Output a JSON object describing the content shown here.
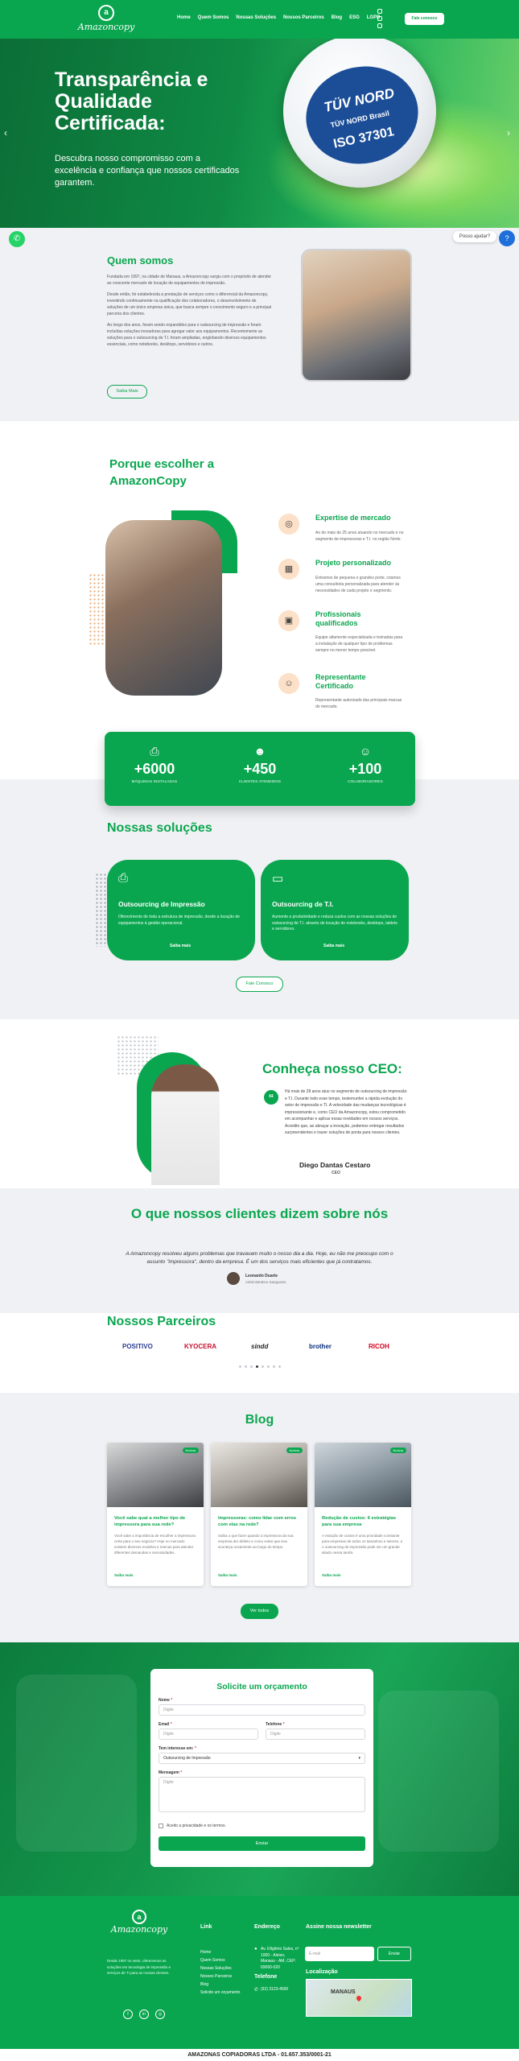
{
  "header": {
    "logo_text": "Amazoncopy",
    "nav": [
      "Home",
      "Quem Somos",
      "Nossas Soluções",
      "Nossos Parceiros",
      "Blog",
      "ESG",
      "LGPD"
    ],
    "cta": "Fale conosco"
  },
  "hero": {
    "title": "Transparência e Qualidade Certificada:",
    "subtitle": "Descubra nosso compromisso com a excelência e confiança que nossos certificados garantem.",
    "badge_line1": "TÜV NORD",
    "badge_line2": "TÜV NORD Brasil",
    "badge_line3": "ISO 37301"
  },
  "float": {
    "help": "Posso ajudar?"
  },
  "about": {
    "title": "Quem somos",
    "p1": "Fundada em 1997, na cidade de Manaus, a Amazoncopy surgiu com o propósito de atender ao crescente mercado de locação de equipamentos de impressão.",
    "p2": "Desde então, foi estabelecida a prestação de serviços como o diferencial da Amazoncopy, investindo continuamente na qualificação dos colaboradores, o desenvolvimento de soluções de um único empresa única, que busca sempre o crescimento seguro e a principal parceria dos clientes.",
    "p3": "Ao longo dos anos, foram sendo expandidos para o outsourcing de impressão e foram incluídas soluções inovadoras para agregar valor aos equipamentos. Recentemente as soluções para o outsourcing de T.I. foram ampliadas, englobando diversos equipamentos essenciais, como notebooks, desktops, servidores e outros.",
    "button": "Saiba Mais"
  },
  "why": {
    "title": "Porque escolher a AmazonCopy",
    "features": [
      {
        "title": "Expertise de mercado",
        "text": "Ao do mais de 25 anos atuando no mercado e no segmento de impressoras e T.I. no região Norte."
      },
      {
        "title": "Projeto personalizado",
        "text": "Entramos de pequena e grandes porte, criamos uma consultoria personalizada para atender às necessidades de cada projeto e segmento."
      },
      {
        "title": "Profissionais qualificados",
        "text": "Equipe altamente especializada e treinadas para a instalação de qualquer tipo de problemas sempre no menor tempo possível."
      },
      {
        "title": "Representante Certificado",
        "text": "Representante autorizado das principais marcas do mercado."
      }
    ]
  },
  "stats": [
    {
      "number": "+6000",
      "label": "MÁQUINAS INSTALADAS"
    },
    {
      "number": "+450",
      "label": "CLIENTES ATENDIDOS"
    },
    {
      "number": "+100",
      "label": "COLABORADORES"
    }
  ],
  "solutions": {
    "title": "Nossas soluções",
    "cards": [
      {
        "title": "Outsourcing de Impressão",
        "text": "Oferecimento de toda a estrutura de impressão, desde a locação de equipamentos à gestão operacional.",
        "more": "Saiba mais"
      },
      {
        "title": "Outsourcing de T.I.",
        "text": "Aumente a produtividade e reduza custos com as nossas soluções de outsourcing de T.I. através de locação de notebooks, desktops, tablets e servidores.",
        "more": "Saiba mais"
      }
    ],
    "button": "Fale Conosco"
  },
  "ceo": {
    "title": "Conheça nosso CEO:",
    "text": "Há mais de 28 anos atuo no segmento de outsourcing de impressão e T.I. Durante todo esse tempo, testemunhei a rápida evolução do setor de impressão e TI. A velocidade das mudanças tecnológicas é impressionante e, como CEO da Amazoncopy, estou comprometido em acompanhar e aplicar essas novidades em nossos serviços. Acredito que, ao abraçar a inovação, podemos entregar resultados surpreendentes e trazer soluções de ponta para nossos clientes.",
    "name": "Diego Dantas Cestaro",
    "role": "CEO"
  },
  "testimonials": {
    "title": "O que nossos clientes dizem sobre nós",
    "quote": "A Amazoncopy resolveu alguns problemas que travavam muito o nosso dia a dia. Hoje, eu não me preocupo com o assunto \"impressora\", dentro da empresa. É um dos serviços mais eficientes que já contratamos.",
    "name": "Leonardo Duarte",
    "role": "Administrativo Sanguexis"
  },
  "partners": {
    "title": "Nossos Parceiros",
    "logos": [
      "POSITIVO",
      "KYOCERA",
      "sindd",
      "brother",
      "RICOH"
    ]
  },
  "blog": {
    "title": "Blog",
    "posts": [
      {
        "tag": "Notícia",
        "title": "Você sabe qual a melhor tipo de impressora para sua rede?",
        "text": "Você sabe a importância de escolher a impressora certa para o seu negócio? Hoje no mercado existem diversos modelos e marcas para atender diferentes demandas e necessidades.",
        "more": "Saiba mais"
      },
      {
        "tag": "Notícia",
        "title": "Impressoras: como lidar com erros com elas na rede?",
        "text": "Saiba o que fazer quando a impressora da sua empresa der defeito e como evitar que isso aconteça novamente ao longo do tempo.",
        "more": "Saiba mais"
      },
      {
        "tag": "Notícia",
        "title": "Redução de custos: 6 estratégias para sua empresa",
        "text": "A redução de custos é uma prioridade constante para empresas de todos os tamanhos e setores, e o outsourcing de impressão pode ser um grande aliado nessa tarefa.",
        "more": "Saiba mais"
      }
    ],
    "button": "Ver todos"
  },
  "form": {
    "title": "Solicite um orçamento",
    "name_label": "Nome",
    "name_placeholder": "Digite",
    "email_label": "Email",
    "email_placeholder": "Digite",
    "phone_label": "Telefone",
    "phone_placeholder": "Digite",
    "interest_label": "Tem interesse em:",
    "interest_value": "Outsourcing de Impressão",
    "message_label": "Mensagem",
    "message_placeholder": "Digite",
    "privacy": "Aceito a privacidade e os termos.",
    "submit": "Enviar"
  },
  "footer": {
    "logo_text": "Amazoncopy",
    "desc": "Desde 1997 no setor, oferecemos as soluções em tecnologia de impressão e serviços de TI para as nossas clientes.",
    "links_title": "Link",
    "links": [
      "Home",
      "Quem Somos",
      "Nossas Soluções",
      "Nossos Parceiros",
      "Blog",
      "Solicite um orçamento"
    ],
    "address_title": "Endereço",
    "address": "Av. Efigênio Sales, nº 1000 - Aleixo, Manaus - AM, CEP: 69060-020",
    "phone_title": "Telefone",
    "phone": "(92) 3123-4500",
    "news_title": "Assine nossa newsletter",
    "news_placeholder": "E-mail",
    "news_button": "Enviar",
    "location_title": "Localização",
    "map_label": "MANAUS"
  },
  "bottom": "AMAZONAS COPIADORAS LTDA - 01.657.353/0001-21"
}
